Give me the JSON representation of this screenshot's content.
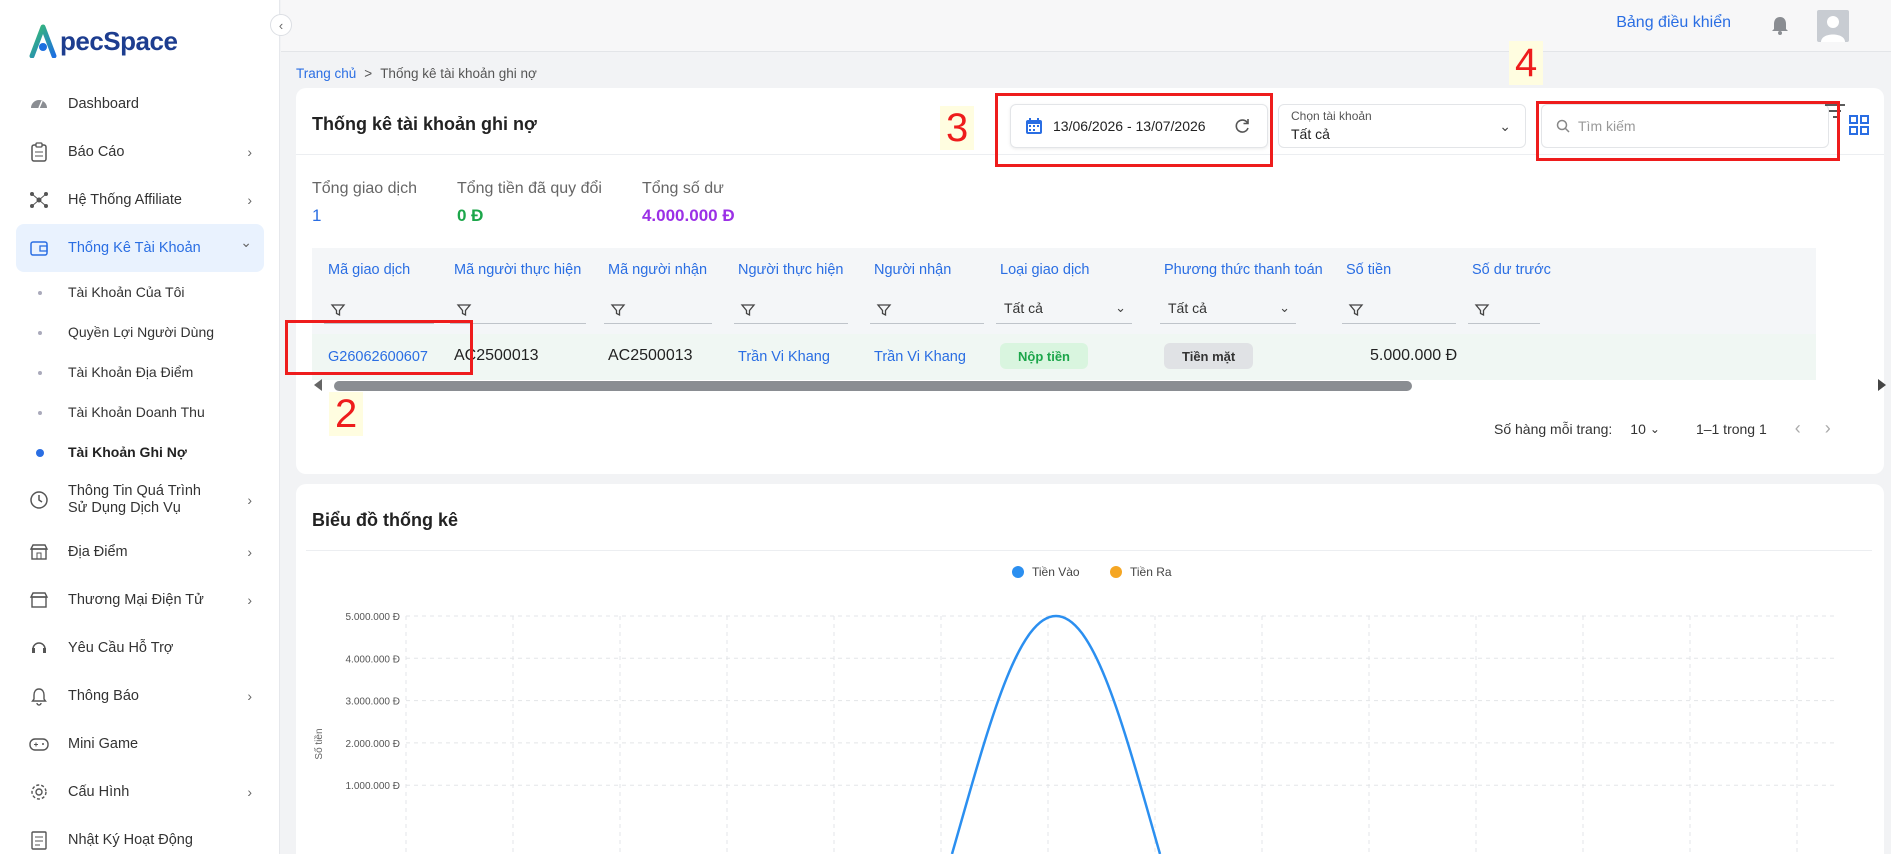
{
  "app": {
    "logo_text": "pecSpace",
    "logo_letter": "A"
  },
  "sidebar": {
    "items": [
      {
        "label": "Dashboard",
        "icon": "dashboard-icon",
        "chevron": false
      },
      {
        "label": "Báo Cáo",
        "icon": "report-icon",
        "chevron": true
      },
      {
        "label": "Hệ Thống Affiliate",
        "icon": "network-icon",
        "chevron": true
      },
      {
        "label": "Thống Kê Tài Khoản",
        "icon": "wallet-icon",
        "chevron": true,
        "expanded": true,
        "active": true
      }
    ],
    "sub_items": [
      "Tài Khoản Của Tôi",
      "Quyền Lợi Người Dùng",
      "Tài Khoản Địa Điểm",
      "Tài Khoản Doanh Thu",
      "Tài Khoản Ghi Nợ"
    ],
    "items_after": [
      {
        "label": "Thông Tin Quá Trình Sử Dụng Dịch Vụ",
        "icon": "clock-icon",
        "chevron": true
      },
      {
        "label": "Địa Điểm",
        "icon": "store-icon",
        "chevron": true
      },
      {
        "label": "Thương Mại Điện Tử",
        "icon": "shop-icon",
        "chevron": true
      },
      {
        "label": "Yêu Cầu Hỗ Trợ",
        "icon": "support-icon",
        "chevron": false
      },
      {
        "label": "Thông Báo",
        "icon": "bell-icon",
        "chevron": true
      },
      {
        "label": "Mini Game",
        "icon": "gamepad-icon",
        "chevron": false
      },
      {
        "label": "Cấu Hình",
        "icon": "gear-icon",
        "chevron": true
      },
      {
        "label": "Nhật Ký Hoạt Động",
        "icon": "log-icon",
        "chevron": false
      }
    ]
  },
  "topbar": {
    "title": "Bảng điều khiển"
  },
  "breadcrumb": {
    "home": "Trang chủ",
    "sep": ">",
    "current": "Thống kê tài khoản ghi nợ"
  },
  "card": {
    "title": "Thống kê tài khoản ghi nợ",
    "date_range": "13/06/2026 - 13/07/2026",
    "account_select_label": "Chọn tài khoản",
    "account_select_value": "Tất cả",
    "search_placeholder": "Tìm kiếm"
  },
  "stats": [
    {
      "label": "Tổng giao dịch",
      "value": "1",
      "color": "#2a6ee3"
    },
    {
      "label": "Tổng tiền đã quy đổi",
      "value": "0 Đ",
      "color": "#1ca64a"
    },
    {
      "label": "Tổng số dư",
      "value": "4.000.000 Đ",
      "color": "#9b30e6"
    }
  ],
  "table": {
    "columns": [
      "Mã giao dịch",
      "Mã người thực hiện",
      "Mã người nhận",
      "Người thực hiện",
      "Người nhận",
      "Loại giao dịch",
      "Phương thức thanh toán",
      "Số tiền",
      "Số dư trước"
    ],
    "filter_all": "Tất cả",
    "rows": [
      {
        "id": "G26062600607",
        "sender_code": "AC2500013",
        "receiver_code": "AC2500013",
        "sender": "Trần Vi Khang",
        "receiver": "Trần Vi Khang",
        "type": "Nộp tiền",
        "method": "Tiền mặt",
        "amount": "5.000.000 Đ",
        "balance_before": ""
      }
    ]
  },
  "pager": {
    "rows_label": "Số hàng mỗi trang:",
    "rows_value": "10",
    "range": "1–1 trong 1"
  },
  "annotations": [
    "2",
    "3",
    "4"
  ],
  "chart_card": {
    "title": "Biểu đồ thống kê"
  },
  "chart_data": {
    "type": "line",
    "title": "",
    "ylabel": "Số tiền",
    "series": [
      {
        "name": "Tiền Vào",
        "color": "#2b8ff0",
        "peak": 5000000
      },
      {
        "name": "Tiền Ra",
        "color": "#f5a623"
      }
    ],
    "y_ticks": [
      "5.000.000 Đ",
      "4.000.000 Đ",
      "3.000.000 Đ",
      "2.000.000 Đ",
      "1.000.000 Đ"
    ],
    "y_tick_values": [
      5000000,
      4000000,
      3000000,
      2000000,
      1000000
    ],
    "ylim": [
      0,
      5000000
    ],
    "grid": true,
    "legend": "top-center"
  }
}
